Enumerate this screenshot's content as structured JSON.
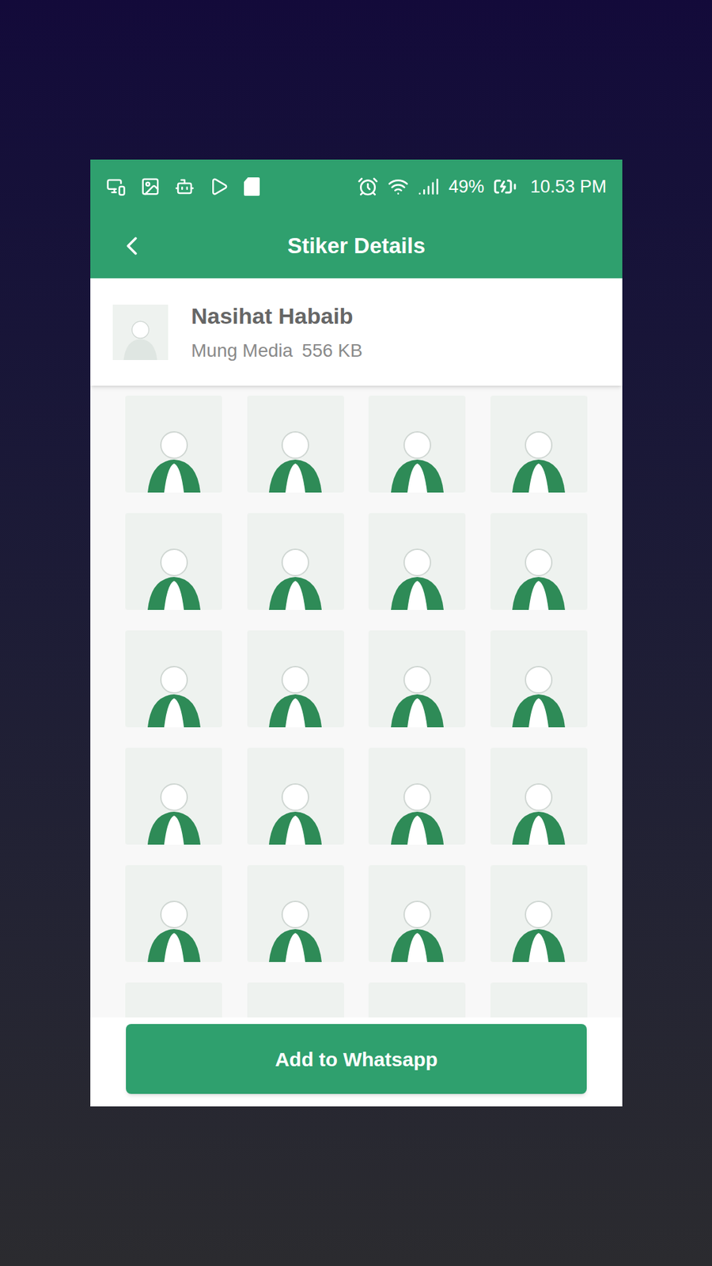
{
  "status_bar": {
    "battery": "49%",
    "time": "10.53 PM"
  },
  "header": {
    "title": "Stiker Details"
  },
  "pack": {
    "name": "Nasihat Habaib",
    "publisher": "Mung Media",
    "size": "556 KB"
  },
  "stickers": [
    {
      "kind": "image"
    },
    {
      "kind": "image"
    },
    {
      "kind": "image"
    },
    {
      "kind": "image"
    },
    {
      "kind": "image"
    },
    {
      "kind": "image"
    },
    {
      "kind": "image"
    },
    {
      "kind": "image"
    },
    {
      "kind": "image"
    },
    {
      "kind": "image"
    },
    {
      "kind": "image"
    },
    {
      "kind": "image"
    },
    {
      "kind": "image"
    },
    {
      "kind": "image"
    },
    {
      "kind": "image"
    },
    {
      "kind": "image"
    },
    {
      "kind": "image"
    },
    {
      "kind": "image"
    },
    {
      "kind": "image"
    },
    {
      "kind": "image"
    },
    {
      "kind": "image"
    },
    {
      "kind": "image"
    },
    {
      "kind": "image"
    },
    {
      "kind": "image"
    }
  ],
  "button": {
    "label": "Add to Whatsapp"
  }
}
